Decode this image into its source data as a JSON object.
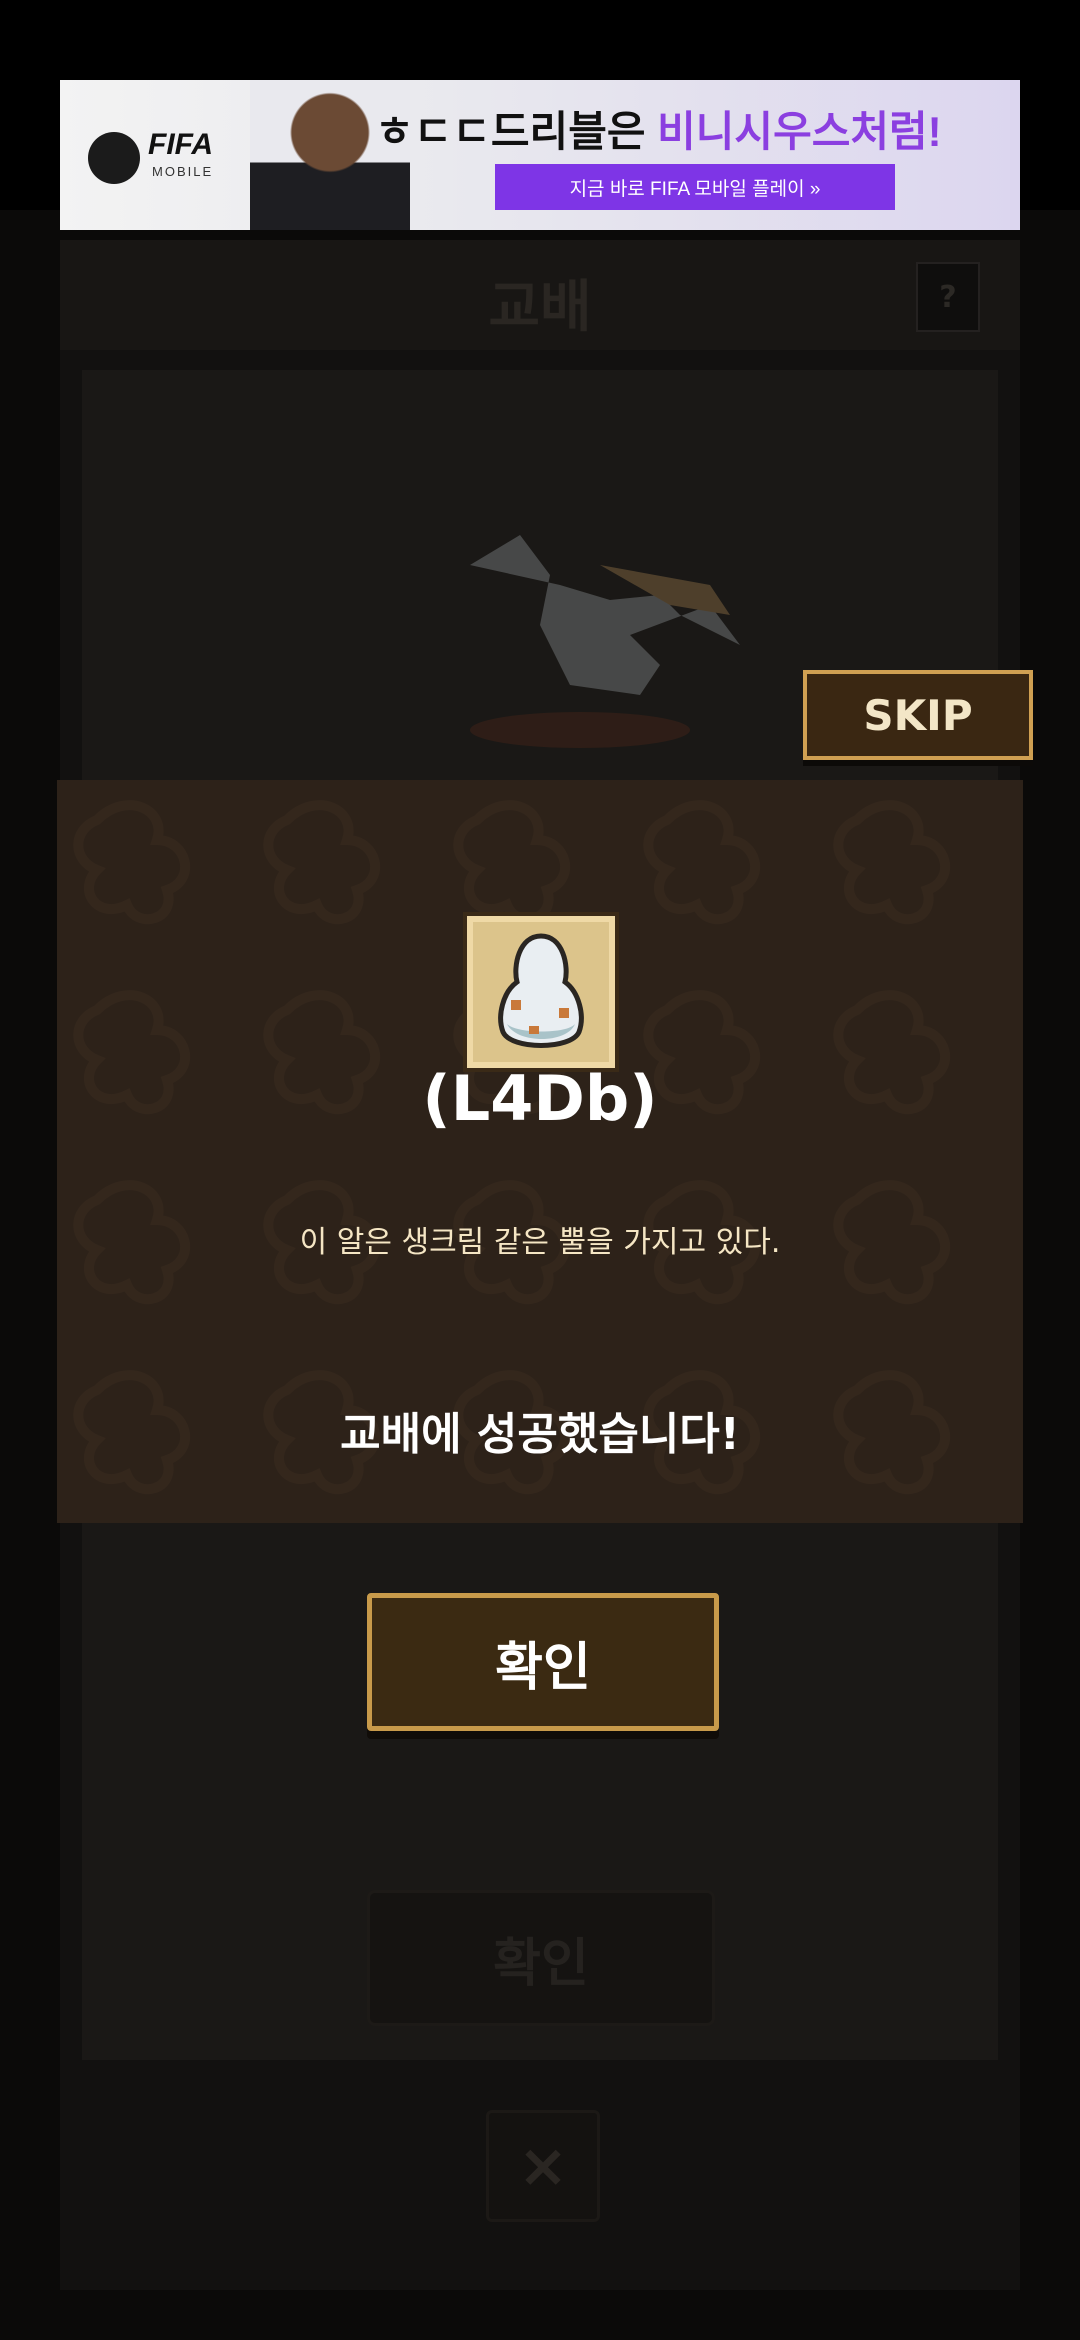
{
  "ad": {
    "brand": "FIFA",
    "brand_sub": "MOBILE",
    "headline_part1": "ㅎㄷㄷ드리블은 ",
    "headline_part2": "비니시우스처럼!",
    "cta": "지금 바로 FIFA 모바일 플레이 »"
  },
  "dialog": {
    "title": "교배",
    "help_label": "?",
    "skip_label": "SKIP",
    "close_icon": "×"
  },
  "result": {
    "item_name": "(L4Db)",
    "item_desc": "이 알은 생크림 같은 뿔을 가지고 있다.",
    "success_message": "교배에 성공했습니다!",
    "egg_icon": "egg-icon"
  },
  "buttons": {
    "confirm_label": "확인",
    "confirm_dim_label": "확인"
  },
  "colors": {
    "panel_bg": "#2d2219",
    "button_border": "#c89a4a",
    "button_fill": "#3b2a12",
    "text_cream": "#f5e6c4"
  }
}
